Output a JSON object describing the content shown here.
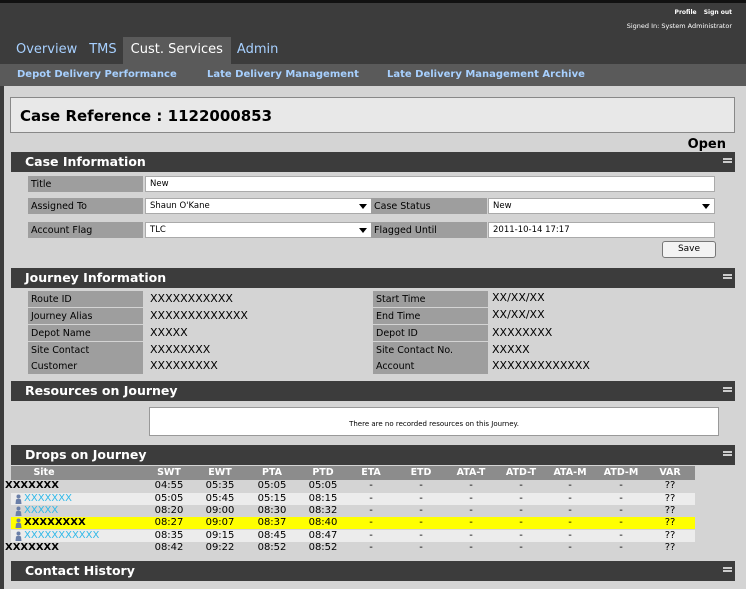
{
  "header": {
    "profile_link": "Profile",
    "signout_link": "Sign out",
    "signed_in": "Signed In: System Administrator",
    "tabs": [
      {
        "label": "Overview"
      },
      {
        "label": "TMS"
      },
      {
        "label": "Cust. Services"
      },
      {
        "label": "Admin"
      }
    ]
  },
  "subnav": {
    "items": [
      {
        "label": "Depot Delivery Performance"
      },
      {
        "label": "Late Delivery Management"
      },
      {
        "label": "Late Delivery Management Archive"
      }
    ]
  },
  "case": {
    "reference": "Case Reference : 1122000853",
    "status_text": "Open"
  },
  "case_information": {
    "header": "Case Information",
    "title_label": "Title",
    "title_value": "New",
    "assigned_label": "Assigned To",
    "assigned_value": "Shaun O'Kane",
    "case_status_label": "Case Status",
    "case_status_value": "New",
    "account_flag_label": "Account Flag",
    "account_flag_value": "TLC",
    "flagged_until_label": "Flagged Until",
    "flagged_until_value": "2011-10-14 17:17",
    "save_label": "Save"
  },
  "journey_information": {
    "header": "Journey Information",
    "left": [
      {
        "label": "Route ID",
        "value": "XXXXXXXXXXX"
      },
      {
        "label": "Journey Alias",
        "value": "XXXXXXXXXXXXX"
      },
      {
        "label": "Depot Name",
        "value": "XXXXX"
      },
      {
        "label": "Site Contact",
        "value": "XXXXXXXX"
      },
      {
        "label": "Customer",
        "value": "XXXXXXXXX"
      }
    ],
    "right": [
      {
        "label": "Start Time",
        "value": "XX/XX/XX"
      },
      {
        "label": "End Time",
        "value": "XX/XX/XX"
      },
      {
        "label": "Depot ID",
        "value": "XXXXXXXX"
      },
      {
        "label": "Site Contact No.",
        "value": "XXXXX"
      },
      {
        "label": "Account",
        "value": "XXXXXXXXXXXXX"
      }
    ]
  },
  "resources": {
    "header": "Resources on Journey",
    "empty_message": "There are no recorded resources on this Journey."
  },
  "drops": {
    "header": "Drops on Journey",
    "columns": [
      "Site",
      "SWT",
      "EWT",
      "PTA",
      "PTD",
      "ETA",
      "ETD",
      "ATA-T",
      "ATD-T",
      "ATA-M",
      "ATD-M",
      "VAR"
    ],
    "rows": [
      {
        "site": "XXXXXXX",
        "swt": "04:55",
        "ewt": "05:35",
        "pta": "05:05",
        "ptd": "05:05",
        "eta": "-",
        "etd": "-",
        "atat": "-",
        "atdt": "-",
        "atam": "-",
        "atdm": "-",
        "var": "??"
      },
      {
        "site": "XXXXXXX",
        "swt": "05:05",
        "ewt": "05:45",
        "pta": "05:15",
        "ptd": "08:15",
        "eta": "-",
        "etd": "-",
        "atat": "-",
        "atdt": "-",
        "atam": "-",
        "atdm": "-",
        "var": "??"
      },
      {
        "site": "XXXXX",
        "swt": "08:20",
        "ewt": "09:00",
        "pta": "08:30",
        "ptd": "08:32",
        "eta": "-",
        "etd": "-",
        "atat": "-",
        "atdt": "-",
        "atam": "-",
        "atdm": "-",
        "var": "??"
      },
      {
        "site": "XXXXXXXX",
        "swt": "08:27",
        "ewt": "09:07",
        "pta": "08:37",
        "ptd": "08:40",
        "eta": "-",
        "etd": "-",
        "atat": "-",
        "atdt": "-",
        "atam": "-",
        "atdm": "-",
        "var": "??"
      },
      {
        "site": "XXXXXXXXXXX",
        "swt": "08:35",
        "ewt": "09:15",
        "pta": "08:45",
        "ptd": "08:47",
        "eta": "-",
        "etd": "-",
        "atat": "-",
        "atdt": "-",
        "atam": "-",
        "atdm": "-",
        "var": "??"
      },
      {
        "site": "XXXXXXX",
        "swt": "08:42",
        "ewt": "09:22",
        "pta": "08:52",
        "ptd": "08:52",
        "eta": "-",
        "etd": "-",
        "atat": "-",
        "atdt": "-",
        "atam": "-",
        "atdm": "-",
        "var": "??"
      }
    ]
  },
  "contact_history": {
    "header": "Contact History"
  },
  "colors": {
    "dark_bar": "#3c3c3c",
    "link": "#a7d0ff",
    "highlight_row": "#ffff00",
    "site_link": "#30b8e8"
  }
}
